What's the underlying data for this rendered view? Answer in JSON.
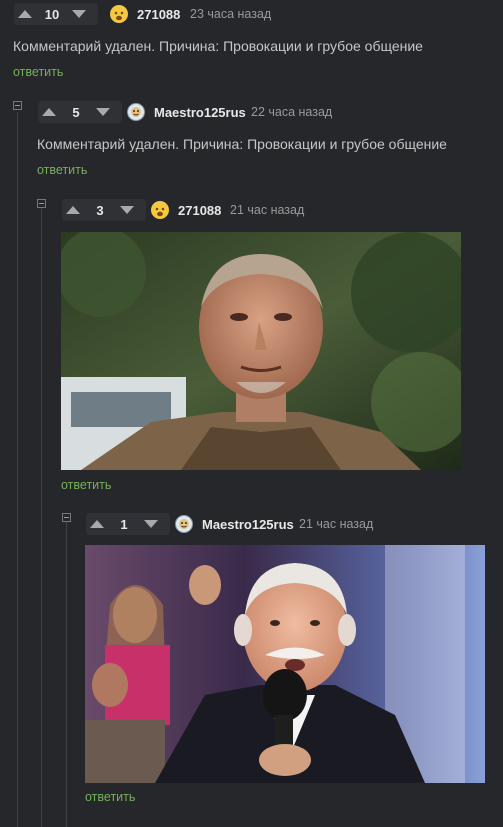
{
  "comments": [
    {
      "score": "10",
      "user": "271088",
      "time": "23 часа назад",
      "text": "Комментарий удален. Причина: Провокации и грубое общение",
      "reply": "ответить"
    },
    {
      "score": "5",
      "user": "Maestro125rus",
      "time": "22 часа назад",
      "text": "Комментарий удален. Причина: Провокации и грубое общение",
      "reply": "ответить"
    },
    {
      "score": "3",
      "user": "271088",
      "time": "21 час назад",
      "reply": "ответить"
    },
    {
      "score": "1",
      "user": "Maestro125rus",
      "time": "21 час назад",
      "reply": "ответить"
    }
  ],
  "colors": {
    "background": "#25272b",
    "reply_link": "#77b05a",
    "username": "#e8e8e8"
  }
}
